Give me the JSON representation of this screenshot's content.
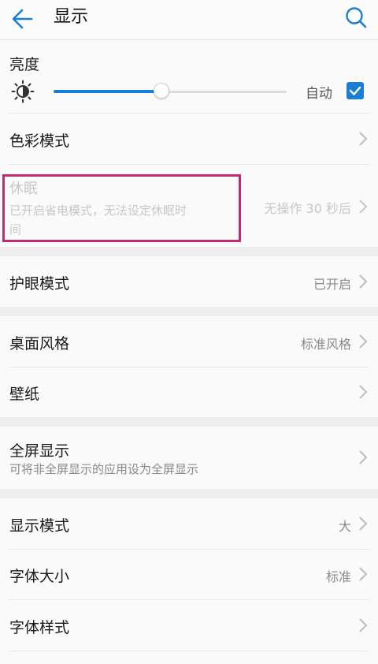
{
  "header": {
    "title": "显示"
  },
  "brightness": {
    "label": "亮度",
    "auto_label": "自动",
    "auto_checked": true,
    "level": 0.46
  },
  "color_mode": {
    "label": "色彩模式"
  },
  "sleep": {
    "label": "休眠",
    "sub_line1": "已开启省电模式，无法设定休眠时",
    "sub_line2": "间",
    "value": "无操作 30 秒后"
  },
  "eye_care": {
    "label": "护眼模式",
    "value": "已开启"
  },
  "desktop_style": {
    "label": "桌面风格",
    "value": "标准风格"
  },
  "wallpaper": {
    "label": "壁纸"
  },
  "fullscreen": {
    "label": "全屏显示",
    "sub": "可将非全屏显示的应用设为全屏显示"
  },
  "display_mode": {
    "label": "显示模式",
    "value": "大"
  },
  "font_size": {
    "label": "字体大小",
    "value": "标准"
  },
  "font_style": {
    "label": "字体样式"
  },
  "colors": {
    "accent": "#1a7fd4",
    "highlight": "#c4286e"
  }
}
